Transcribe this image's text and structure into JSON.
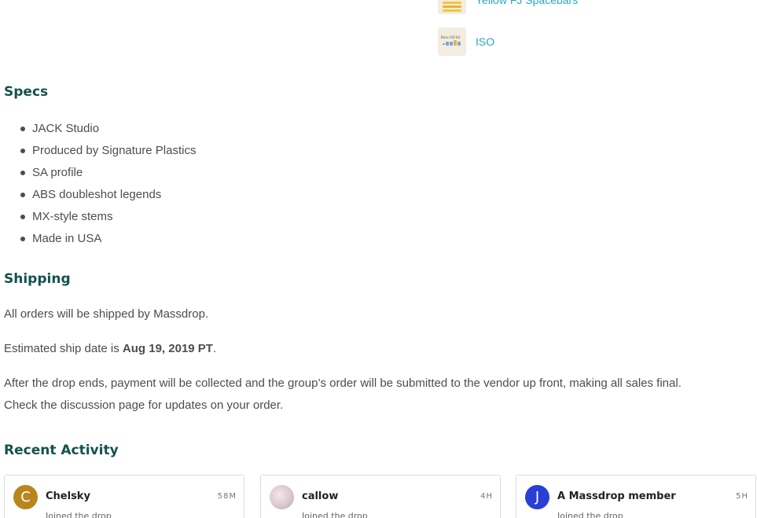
{
  "addons": [
    {
      "label": "Yellow FJ Spacebars",
      "icon": "spacebar-thumbnail"
    },
    {
      "label": "ISO",
      "icon": "iso-keys-thumbnail",
      "thumb_text": "Base ISO Kit"
    }
  ],
  "specs": {
    "heading": "Specs",
    "items": [
      "JACK Studio",
      "Produced by Signature Plastics",
      "SA profile",
      "ABS doubleshot legends",
      "MX-style stems",
      "Made in USA"
    ]
  },
  "shipping": {
    "heading": "Shipping",
    "line1": "All orders will be shipped by Massdrop.",
    "ship_prefix": "Estimated ship date is ",
    "ship_date": "Aug 19, 2019 PT",
    "ship_suffix": ".",
    "line3": "After the drop ends, payment will be collected and the group’s order will be submitted to the vendor up front, making all sales final.",
    "line4": "Check the discussion page for updates on your order."
  },
  "recent_activity": {
    "heading": "Recent Activity",
    "cards": [
      {
        "initial": "C",
        "username": "Chelsky",
        "time": "58M",
        "action": "Joined the drop",
        "avatar_color": "#b8861b"
      },
      {
        "initial": "",
        "username": "callow",
        "time": "4H",
        "action": "Joined the drop",
        "avatar_color": "#d9c8cf"
      },
      {
        "initial": "J",
        "username": "A Massdrop member",
        "time": "5H",
        "action": "Joined the drop",
        "avatar_color": "#2a3fd6"
      }
    ]
  },
  "colors": {
    "heading": "#14524d",
    "link": "#2aa7c9",
    "body_text": "#4d4d4d"
  }
}
